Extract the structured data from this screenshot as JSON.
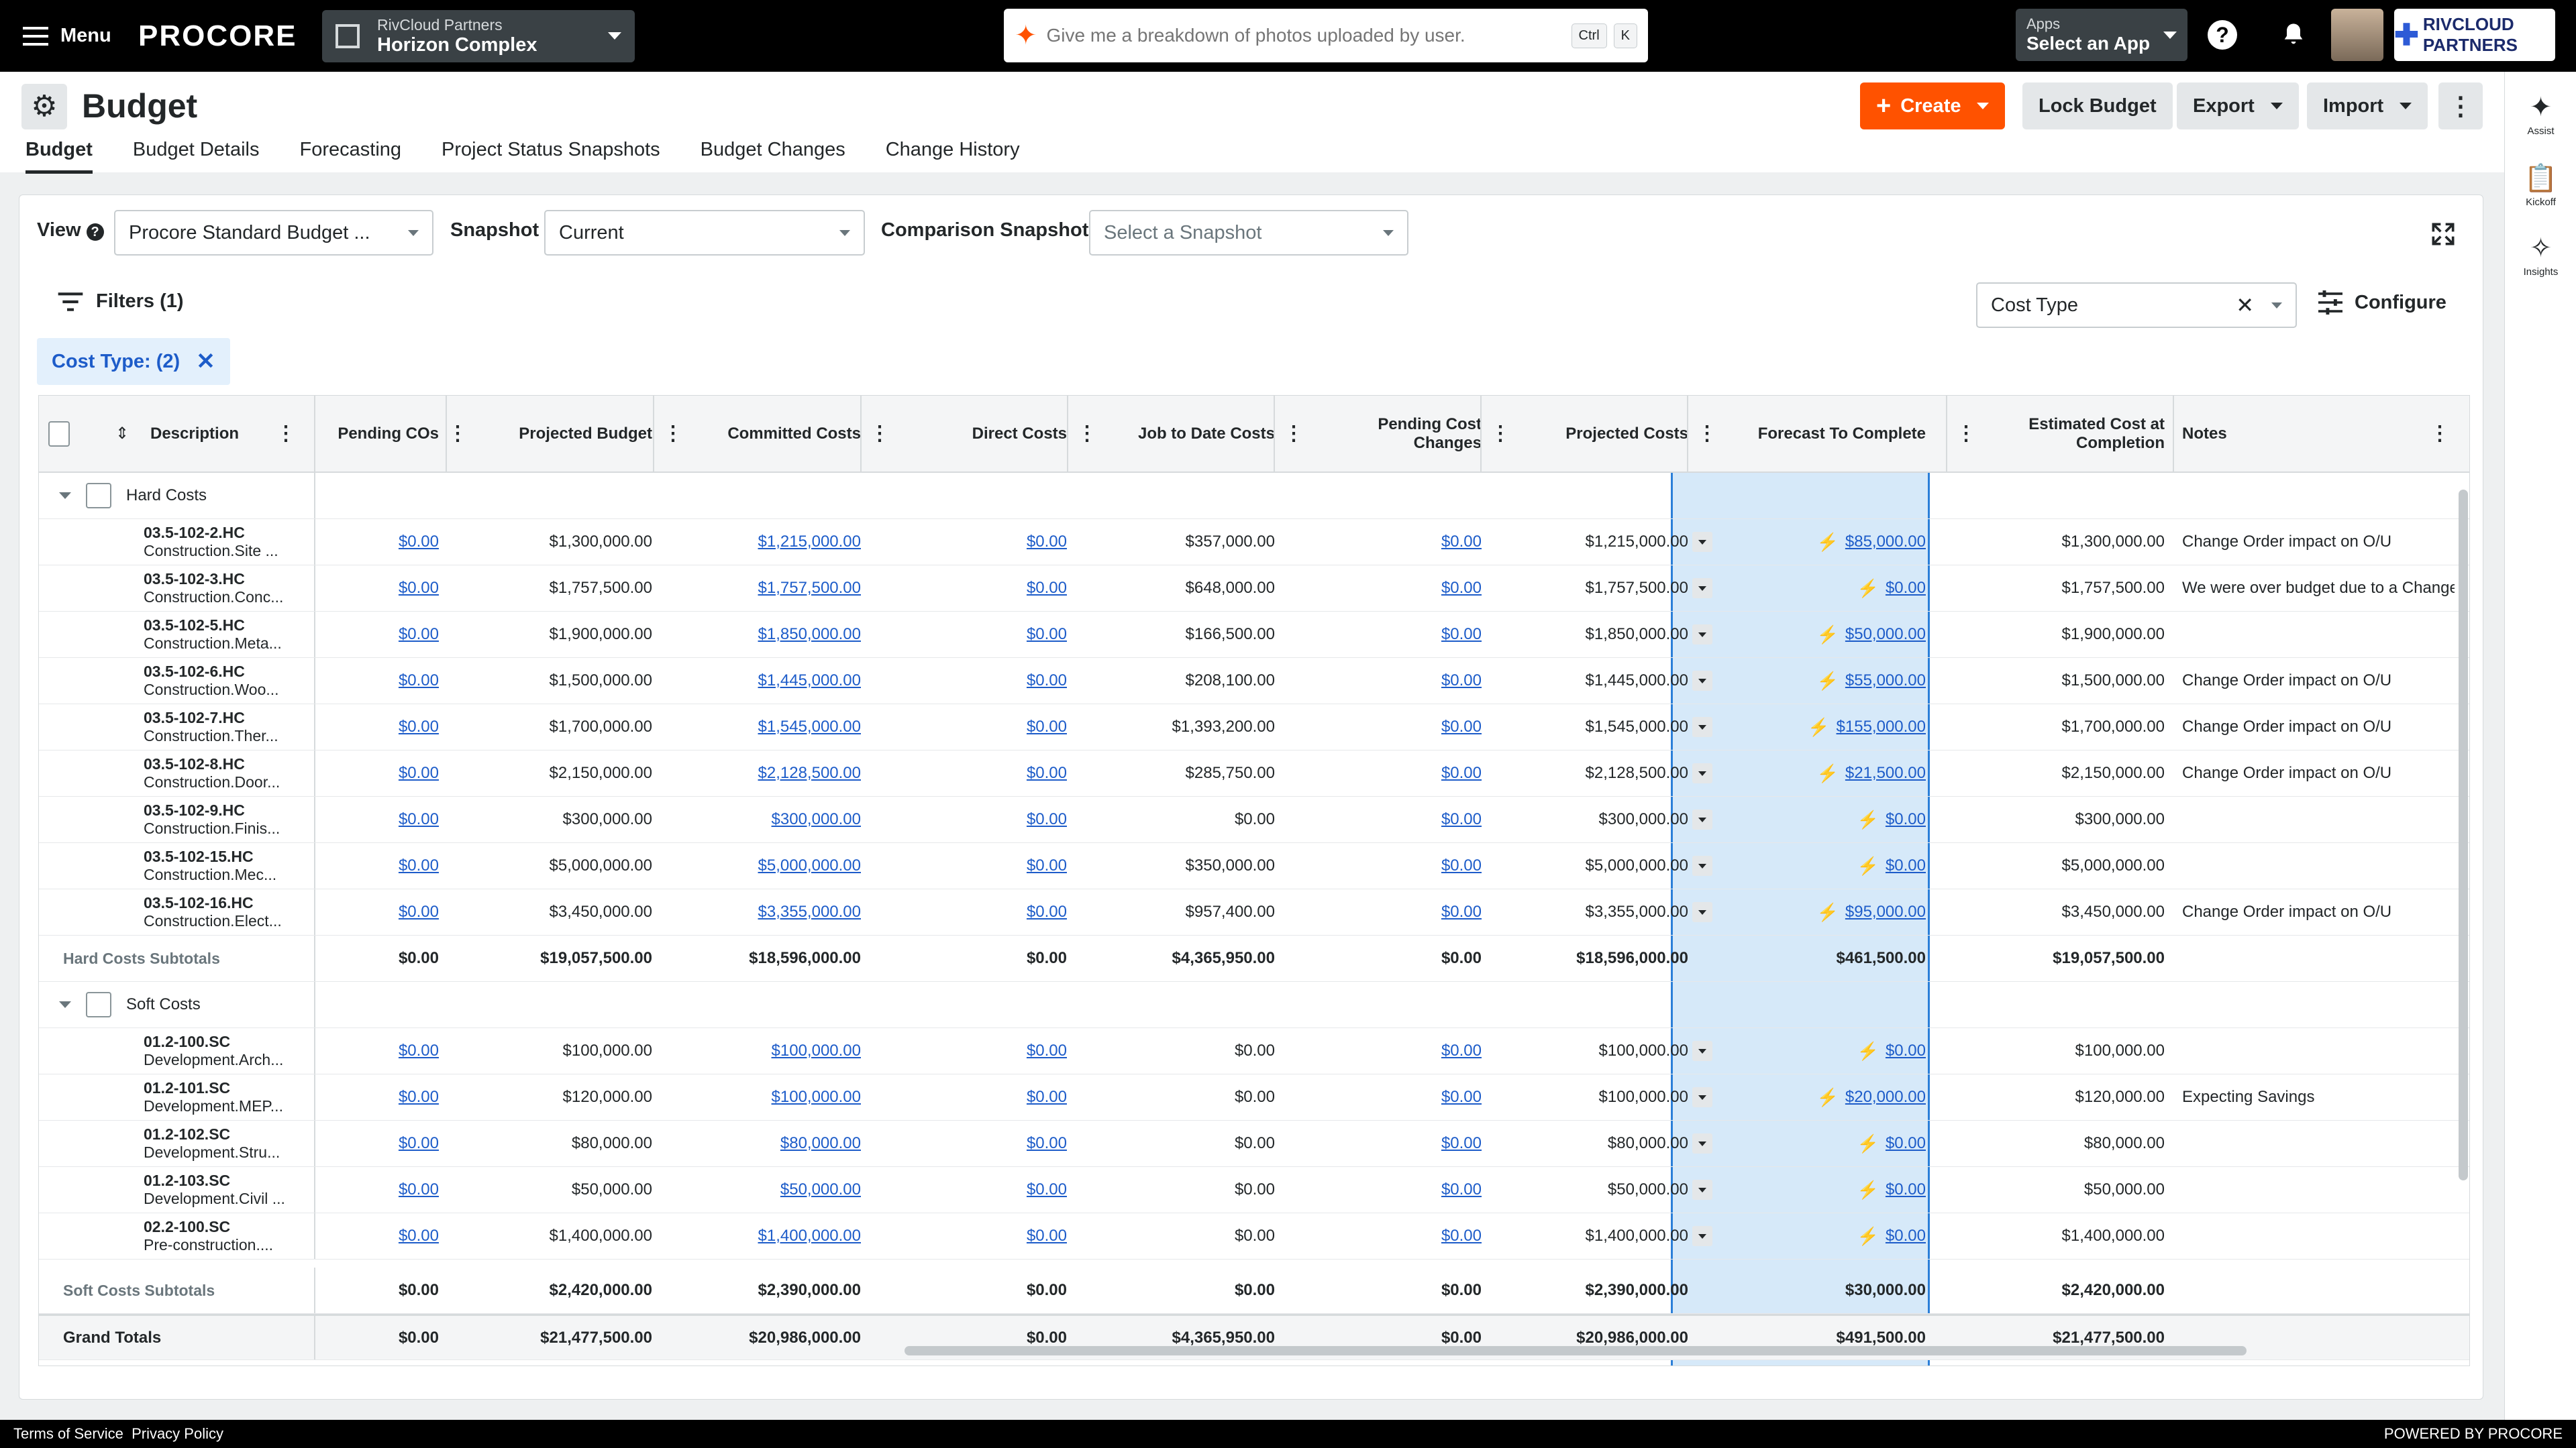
{
  "topbar": {
    "menu_label": "Menu",
    "logo": "PROCORE",
    "company": "RivCloud Partners",
    "project": "Horizon Complex",
    "search_placeholder": "Give me a breakdown of photos uploaded by user.",
    "shortcut_ctrl": "Ctrl",
    "shortcut_k": "K",
    "apps_label": "Apps",
    "apps_value": "Select an App",
    "brand": "RIVCLOUD PARTNERS"
  },
  "rail": {
    "assist": "Assist",
    "kickoff": "Kickoff",
    "insights": "Insights"
  },
  "page": {
    "title": "Budget",
    "buttons": {
      "create": "Create",
      "lock": "Lock Budget",
      "export": "Export",
      "import": "Import"
    },
    "tabs": [
      "Budget",
      "Budget Details",
      "Forecasting",
      "Project Status Snapshots",
      "Budget Changes",
      "Change History"
    ]
  },
  "controls": {
    "view_label": "View",
    "view_value": "Procore Standard Budget ...",
    "snapshot_label": "Snapshot",
    "snapshot_value": "Current",
    "comparison_label": "Comparison Snapshot",
    "comparison_placeholder": "Select a Snapshot",
    "filters_label": "Filters",
    "filters_count": "(1)",
    "chip_label": "Cost Type: (2)",
    "group_by_value": "Cost Type",
    "configure_label": "Configure"
  },
  "table": {
    "headers": {
      "description": "Description",
      "pending_cos": "Pending COs",
      "projected_budget": "Projected Budget",
      "committed_costs": "Committed Costs",
      "direct_costs": "Direct Costs",
      "job_to_date": "Job to Date Costs",
      "pending_cost_changes_1": "Pending Cost",
      "pending_cost_changes_2": "Changes",
      "projected_costs": "Projected Costs",
      "forecast": "Forecast To Complete",
      "estimated_1": "Estimated Cost at",
      "estimated_2": "Completion",
      "notes": "Notes"
    },
    "hard": {
      "label": "Hard Costs",
      "rows": [
        {
          "code": "03.5-102-2.HC",
          "desc": "Construction.Site ...",
          "pco": "$0.00",
          "pb": "$1,300,000.00",
          "cc": "$1,215,000.00",
          "dc": "$0.00",
          "jtd": "$357,000.00",
          "pcc": "$0.00",
          "pc": "$1,215,000.00",
          "ftc": "$85,000.00",
          "eac": "$1,300,000.00",
          "notes": "Change Order impact on O/U"
        },
        {
          "code": "03.5-102-3.HC",
          "desc": "Construction.Conc...",
          "pco": "$0.00",
          "pb": "$1,757,500.00",
          "cc": "$1,757,500.00",
          "dc": "$0.00",
          "jtd": "$648,000.00",
          "pcc": "$0.00",
          "pc": "$1,757,500.00",
          "ftc": "$0.00",
          "eac": "$1,757,500.00",
          "notes": "We were over budget due to a Change ..."
        },
        {
          "code": "03.5-102-5.HC",
          "desc": "Construction.Meta...",
          "pco": "$0.00",
          "pb": "$1,900,000.00",
          "cc": "$1,850,000.00",
          "dc": "$0.00",
          "jtd": "$166,500.00",
          "pcc": "$0.00",
          "pc": "$1,850,000.00",
          "ftc": "$50,000.00",
          "eac": "$1,900,000.00",
          "notes": ""
        },
        {
          "code": "03.5-102-6.HC",
          "desc": "Construction.Woo...",
          "pco": "$0.00",
          "pb": "$1,500,000.00",
          "cc": "$1,445,000.00",
          "dc": "$0.00",
          "jtd": "$208,100.00",
          "pcc": "$0.00",
          "pc": "$1,445,000.00",
          "ftc": "$55,000.00",
          "eac": "$1,500,000.00",
          "notes": "Change Order impact on O/U"
        },
        {
          "code": "03.5-102-7.HC",
          "desc": "Construction.Ther...",
          "pco": "$0.00",
          "pb": "$1,700,000.00",
          "cc": "$1,545,000.00",
          "dc": "$0.00",
          "jtd": "$1,393,200.00",
          "pcc": "$0.00",
          "pc": "$1,545,000.00",
          "ftc": "$155,000.00",
          "eac": "$1,700,000.00",
          "notes": "Change Order impact on O/U"
        },
        {
          "code": "03.5-102-8.HC",
          "desc": "Construction.Door...",
          "pco": "$0.00",
          "pb": "$2,150,000.00",
          "cc": "$2,128,500.00",
          "dc": "$0.00",
          "jtd": "$285,750.00",
          "pcc": "$0.00",
          "pc": "$2,128,500.00",
          "ftc": "$21,500.00",
          "eac": "$2,150,000.00",
          "notes": "Change Order impact on O/U"
        },
        {
          "code": "03.5-102-9.HC",
          "desc": "Construction.Finis...",
          "pco": "$0.00",
          "pb": "$300,000.00",
          "cc": "$300,000.00",
          "dc": "$0.00",
          "jtd": "$0.00",
          "pcc": "$0.00",
          "pc": "$300,000.00",
          "ftc": "$0.00",
          "eac": "$300,000.00",
          "notes": ""
        },
        {
          "code": "03.5-102-15.HC",
          "desc": "Construction.Mec...",
          "pco": "$0.00",
          "pb": "$5,000,000.00",
          "cc": "$5,000,000.00",
          "dc": "$0.00",
          "jtd": "$350,000.00",
          "pcc": "$0.00",
          "pc": "$5,000,000.00",
          "ftc": "$0.00",
          "eac": "$5,000,000.00",
          "notes": ""
        },
        {
          "code": "03.5-102-16.HC",
          "desc": "Construction.Elect...",
          "pco": "$0.00",
          "pb": "$3,450,000.00",
          "cc": "$3,355,000.00",
          "dc": "$0.00",
          "jtd": "$957,400.00",
          "pcc": "$0.00",
          "pc": "$3,355,000.00",
          "ftc": "$95,000.00",
          "eac": "$3,450,000.00",
          "notes": "Change Order impact on O/U"
        }
      ],
      "subtotal": {
        "label": "Hard Costs Subtotals",
        "pco": "$0.00",
        "pb": "$19,057,500.00",
        "cc": "$18,596,000.00",
        "dc": "$0.00",
        "jtd": "$4,365,950.00",
        "pcc": "$0.00",
        "pc": "$18,596,000.00",
        "ftc": "$461,500.00",
        "eac": "$19,057,500.00"
      }
    },
    "soft": {
      "label": "Soft Costs",
      "rows": [
        {
          "code": "01.2-100.SC",
          "desc": "Development.Arch...",
          "pco": "$0.00",
          "pb": "$100,000.00",
          "cc": "$100,000.00",
          "dc": "$0.00",
          "jtd": "$0.00",
          "pcc": "$0.00",
          "pc": "$100,000.00",
          "ftc": "$0.00",
          "eac": "$100,000.00",
          "notes": ""
        },
        {
          "code": "01.2-101.SC",
          "desc": "Development.MEP...",
          "pco": "$0.00",
          "pb": "$120,000.00",
          "cc": "$100,000.00",
          "dc": "$0.00",
          "jtd": "$0.00",
          "pcc": "$0.00",
          "pc": "$100,000.00",
          "ftc": "$20,000.00",
          "eac": "$120,000.00",
          "notes": "Expecting Savings"
        },
        {
          "code": "01.2-102.SC",
          "desc": "Development.Stru...",
          "pco": "$0.00",
          "pb": "$80,000.00",
          "cc": "$80,000.00",
          "dc": "$0.00",
          "jtd": "$0.00",
          "pcc": "$0.00",
          "pc": "$80,000.00",
          "ftc": "$0.00",
          "eac": "$80,000.00",
          "notes": ""
        },
        {
          "code": "01.2-103.SC",
          "desc": "Development.Civil ...",
          "pco": "$0.00",
          "pb": "$50,000.00",
          "cc": "$50,000.00",
          "dc": "$0.00",
          "jtd": "$0.00",
          "pcc": "$0.00",
          "pc": "$50,000.00",
          "ftc": "$0.00",
          "eac": "$50,000.00",
          "notes": ""
        },
        {
          "code": "02.2-100.SC",
          "desc": "Pre-construction....",
          "pco": "$0.00",
          "pb": "$1,400,000.00",
          "cc": "$1,400,000.00",
          "dc": "$0.00",
          "jtd": "$0.00",
          "pcc": "$0.00",
          "pc": "$1,400,000.00",
          "ftc": "$0.00",
          "eac": "$1,400,000.00",
          "notes": ""
        }
      ],
      "subtotal": {
        "label": "Soft Costs Subtotals",
        "pco": "$0.00",
        "pb": "$2,420,000.00",
        "cc": "$2,390,000.00",
        "dc": "$0.00",
        "jtd": "$0.00",
        "pcc": "$0.00",
        "pc": "$2,390,000.00",
        "ftc": "$30,000.00",
        "eac": "$2,420,000.00"
      }
    },
    "grand": {
      "label": "Grand Totals",
      "pco": "$0.00",
      "pb": "$21,477,500.00",
      "cc": "$20,986,000.00",
      "dc": "$0.00",
      "jtd": "$4,365,950.00",
      "pcc": "$0.00",
      "pc": "$20,986,000.00",
      "ftc": "$491,500.00",
      "eac": "$21,477,500.00"
    }
  },
  "footer": {
    "terms": "Terms of Service",
    "privacy": "Privacy Policy",
    "powered": "POWERED BY PROCORE"
  }
}
